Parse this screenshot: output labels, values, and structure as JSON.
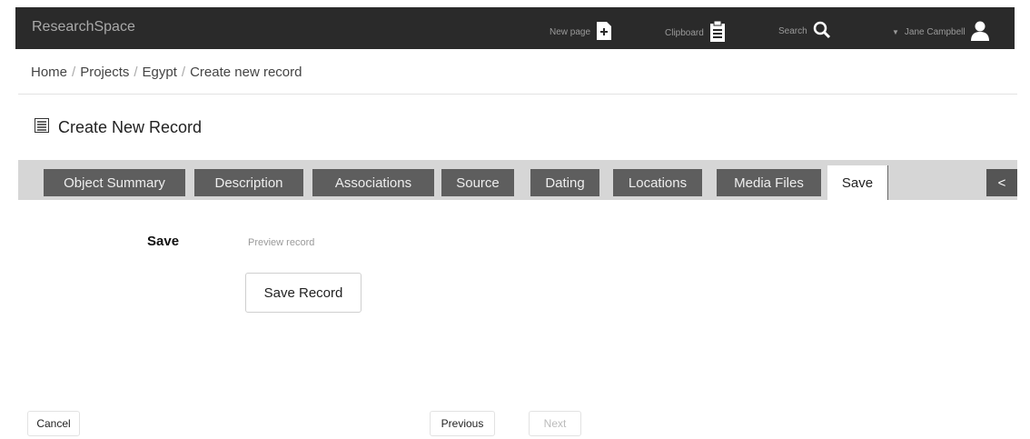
{
  "header": {
    "brand": "ResearchSpace",
    "new_page": "New page",
    "clipboard": "Clipboard",
    "search": "Search",
    "user": "Jane Campbell"
  },
  "breadcrumb": [
    "Home",
    "Projects",
    "Egypt",
    "Create new record"
  ],
  "page_title": "Create New Record",
  "tabs": [
    "Object Summary",
    "Description",
    "Associations",
    "Source",
    "Dating",
    "Locations",
    "Media Files",
    "Save"
  ],
  "active_tab": "Save",
  "pager_label": "<",
  "save_section": {
    "label": "Save",
    "preview": "Preview record",
    "save_button": "Save Record"
  },
  "footer": {
    "cancel": "Cancel",
    "previous": "Previous",
    "next": "Next"
  }
}
